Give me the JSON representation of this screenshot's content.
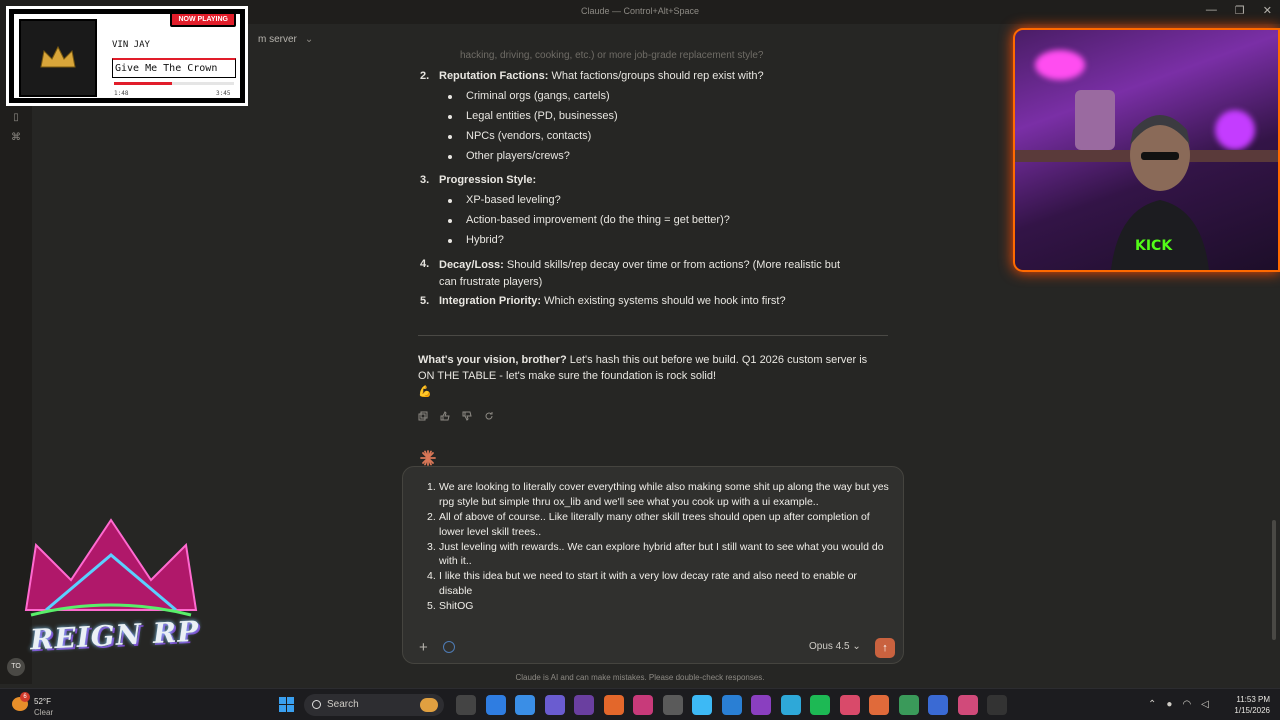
{
  "window": {
    "title": "Claude — Control+Alt+Space",
    "controls": [
      "—",
      "❐",
      "✕"
    ]
  },
  "breadcrumb": {
    "label": "m server"
  },
  "now_playing": {
    "badge": "NOW PLAYING",
    "artist": "VIN JAY",
    "track": "Give Me The Crown",
    "elapsed": "1:48",
    "duration": "3:45",
    "progress": 0.48
  },
  "message": {
    "faded_line": "hacking, driving, cooking, etc.) or more job-grade replacement style?",
    "items": [
      {
        "n": "2.",
        "title": "Reputation Factions:",
        "text": " What factions/groups should rep exist with?",
        "bullets": [
          "Criminal orgs (gangs, cartels)",
          "Legal entities (PD, businesses)",
          "NPCs (vendors, contacts)",
          "Other players/crews?"
        ]
      },
      {
        "n": "3.",
        "title": "Progression Style:",
        "text": "",
        "bullets": [
          "XP-based leveling?",
          "Action-based improvement (do the thing = get better)?",
          "Hybrid?"
        ]
      },
      {
        "n": "4.",
        "title": "Decay/Loss:",
        "text": " Should skills/rep decay over time or from actions? (More realistic but can frustrate players)",
        "bullets": []
      },
      {
        "n": "5.",
        "title": "Integration Priority:",
        "text": " Which existing systems should we hook into first?",
        "bullets": []
      }
    ],
    "closing_bold": "What's your vision, brother?",
    "closing_text": " Let's hash this out before we build. Q1 2026 custom server is ON THE TABLE - let's make sure the foundation is rock solid!",
    "closing_emoji": "💪",
    "actions": [
      "copy",
      "thumbs-up",
      "thumbs-down",
      "retry"
    ]
  },
  "composer": {
    "items": [
      {
        "n": "1.",
        "text": "We are looking to literally cover everything while also making some shit up along the way but yes rpg style but simple thru ox_lib and we'll see what you cook up with a ui example.."
      },
      {
        "n": "2.",
        "text": "All of above of course.. Like literally many other skill trees should open up after completion of lower level skill trees.."
      },
      {
        "n": "3.",
        "text": "Just leveling with rewards.. We can explore hybrid after but I still want to see what you would do with it.."
      },
      {
        "n": "4.",
        "text": "I like this idea but we need to start it with a very low decay rate and also need to enable or disable"
      },
      {
        "n": "5.",
        "text": "ShitOG"
      }
    ],
    "plus": "+",
    "model": "Opus 4.5",
    "model_chevron": "⌄",
    "send": "↑"
  },
  "footer_note": "Claude is AI and can make mistakes. Please double-check responses.",
  "overlay_logo_text": "REIGN RP",
  "avatar_initials": "TO",
  "taskbar": {
    "weather_temp": "52°F",
    "weather_cond": "Clear",
    "weather_badge": "6",
    "search_label": "Search",
    "clock_time": "11:53 PM",
    "clock_date": "1/15/2026",
    "app_colors": [
      "#444",
      "#2f7de1",
      "#3a8ee6",
      "#6a5cd0",
      "#6a3fa0",
      "#e3672b",
      "#c83a7a",
      "#5a5a5a",
      "#3db9f5",
      "#2a7fd4",
      "#8a3fc0",
      "#2ea8d8",
      "#1db954",
      "#d94a6a",
      "#e06a3a",
      "#3a9a5a",
      "#3a6ad4",
      "#d14a7a",
      "#333"
    ]
  }
}
